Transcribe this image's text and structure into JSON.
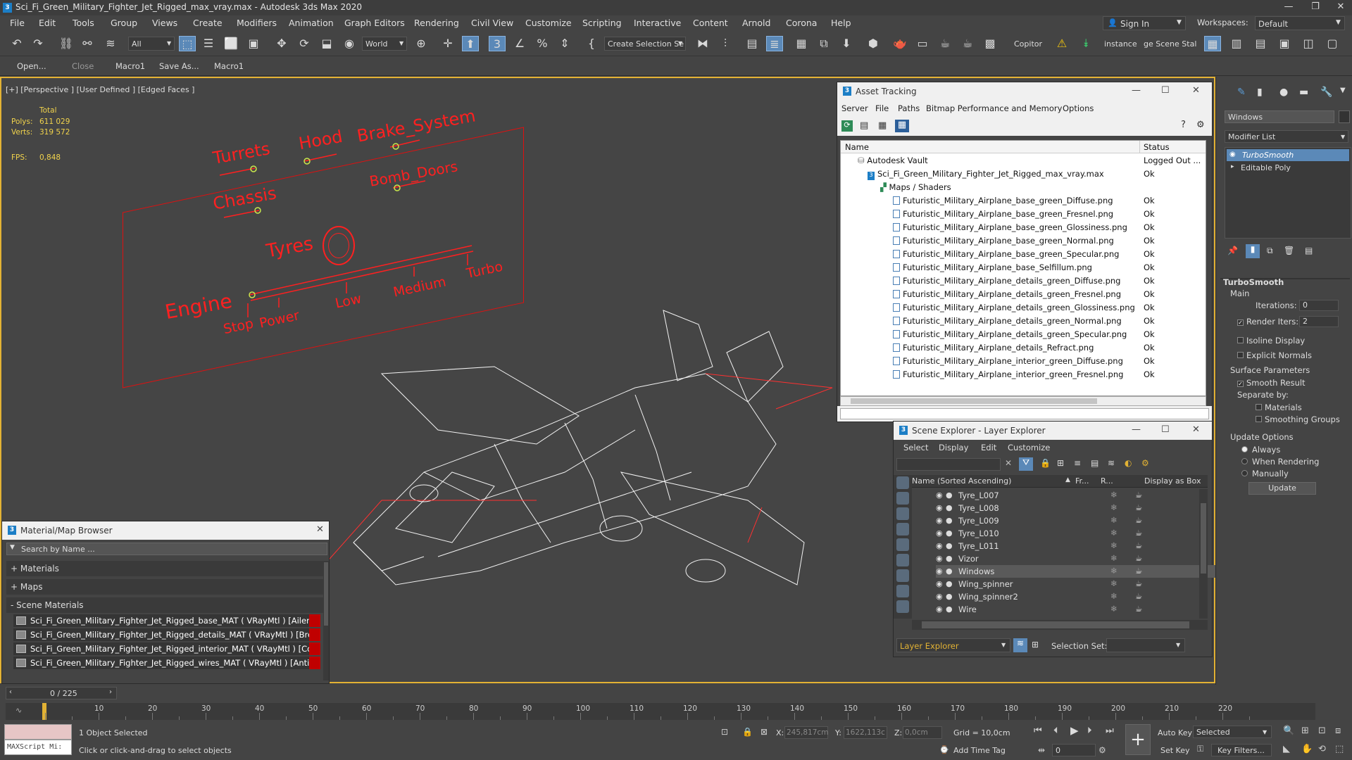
{
  "window": {
    "title": "Sci_Fi_Green_Military_Fighter_Jet_Rigged_max_vray.max - Autodesk 3ds Max 2020"
  },
  "menu": [
    "File",
    "Edit",
    "Tools",
    "Group",
    "Views",
    "Create",
    "Modifiers",
    "Animation",
    "Graph Editors",
    "Rendering",
    "Civil View",
    "Customize",
    "Scripting",
    "Interactive",
    "Content",
    "Arnold",
    "Corona",
    "Help"
  ],
  "account": {
    "sign_in": "Sign In",
    "workspaces_label": "Workspaces:",
    "workspace": "Default"
  },
  "toolbar": {
    "filter": "All",
    "coord": "World",
    "selection_set": "Create Selection Se",
    "copitor": "Copitor",
    "instance": "instance",
    "ge_scene": "ge Scene Stal"
  },
  "toolbar2": {
    "open": "Open...",
    "close": "Close",
    "macro1": "Macro1",
    "save_as": "Save As...",
    "macro1b": "Macro1"
  },
  "viewport": {
    "label": "[+] [Perspective ] [User Defined ] [Edged Faces ]",
    "stats_total": "Total",
    "polys_label": "Polys:",
    "polys": "611 029",
    "verts_label": "Verts:",
    "verts": "319 572",
    "fps_label": "FPS:",
    "fps": "0,848"
  },
  "rig_panel": {
    "turrets": "Turrets",
    "hood": "Hood",
    "brake": "Brake_System",
    "chassis": "Chassis",
    "bomb_doors": "Bomb_Doors",
    "tyres": "Tyres",
    "engine": "Engine",
    "stop": "Stop",
    "power": "Power",
    "low": "Low",
    "medium": "Medium",
    "turbo": "Turbo"
  },
  "asset_tracking": {
    "title": "Asset Tracking",
    "menu": [
      "Server",
      "File",
      "Paths",
      "Bitmap Performance and Memory",
      "Options"
    ],
    "col_name": "Name",
    "col_status": "Status",
    "vault": {
      "name": "Autodesk Vault",
      "status": "Logged Out ..."
    },
    "file": {
      "name": "Sci_Fi_Green_Military_Fighter_Jet_Rigged_max_vray.max",
      "status": "Ok"
    },
    "maps_folder": "Maps / Shaders",
    "maps": [
      {
        "name": "Futuristic_Military_Airplane_base_green_Diffuse.png",
        "status": "Ok"
      },
      {
        "name": "Futuristic_Military_Airplane_base_green_Fresnel.png",
        "status": "Ok"
      },
      {
        "name": "Futuristic_Military_Airplane_base_green_Glossiness.png",
        "status": "Ok"
      },
      {
        "name": "Futuristic_Military_Airplane_base_green_Normal.png",
        "status": "Ok"
      },
      {
        "name": "Futuristic_Military_Airplane_base_green_Specular.png",
        "status": "Ok"
      },
      {
        "name": "Futuristic_Military_Airplane_base_Selfillum.png",
        "status": "Ok"
      },
      {
        "name": "Futuristic_Military_Airplane_details_green_Diffuse.png",
        "status": "Ok"
      },
      {
        "name": "Futuristic_Military_Airplane_details_green_Fresnel.png",
        "status": "Ok"
      },
      {
        "name": "Futuristic_Military_Airplane_details_green_Glossiness.png",
        "status": "Ok"
      },
      {
        "name": "Futuristic_Military_Airplane_details_green_Normal.png",
        "status": "Ok"
      },
      {
        "name": "Futuristic_Military_Airplane_details_green_Specular.png",
        "status": "Ok"
      },
      {
        "name": "Futuristic_Military_Airplane_details_Refract.png",
        "status": "Ok"
      },
      {
        "name": "Futuristic_Military_Airplane_interior_green_Diffuse.png",
        "status": "Ok"
      },
      {
        "name": "Futuristic_Military_Airplane_interior_green_Fresnel.png",
        "status": "Ok"
      }
    ]
  },
  "scene_explorer": {
    "title": "Scene Explorer - Layer Explorer",
    "menu": [
      "Select",
      "Display",
      "Edit",
      "Customize"
    ],
    "col_name": "Name (Sorted Ascending)",
    "col_fr": "Fr...",
    "col_r": "R...",
    "col_box": "Display as Box",
    "rows": [
      "Tyre_L007",
      "Tyre_L008",
      "Tyre_L009",
      "Tyre_L010",
      "Tyre_L011",
      "Vizor",
      "Windows",
      "Wing_spinner",
      "Wing_spinner2",
      "Wire"
    ],
    "selected_row": "Windows",
    "layer_explorer": "Layer Explorer",
    "selection_set_label": "Selection Set:"
  },
  "material_browser": {
    "title": "Material/Map Browser",
    "search_placeholder": "Search by Name ...",
    "materials": "+ Materials",
    "maps": "+ Maps",
    "scene_materials": "- Scene Materials",
    "items": [
      "Sci_Fi_Green_Military_Fighter_Jet_Rigged_base_MAT ( VRayMtl ) [Aileron_LB,...",
      "Sci_Fi_Green_Military_Fighter_Jet_Rigged_details_MAT ( VRayMtl ) [Break_Di...",
      "Sci_Fi_Green_Military_Fighter_Jet_Rigged_interior_MAT ( VRayMtl ) [Cocpit, C...",
      "Sci_Fi_Green_Military_Fighter_Jet_Rigged_wires_MAT ( VRayMtl ) [Antigravity..."
    ]
  },
  "command_panel": {
    "object_name": "Windows",
    "modifier_list": "Modifier List",
    "stack": [
      "TurboSmooth",
      "Editable Poly"
    ],
    "rollout": "TurboSmooth",
    "main": "Main",
    "iterations_label": "Iterations:",
    "iterations": "0",
    "render_iters_label": "Render Iters:",
    "render_iters": "2",
    "isoline": "Isoline Display",
    "explicit_normals": "Explicit Normals",
    "surface_params": "Surface Parameters",
    "smooth_result": "Smooth Result",
    "separate_by": "Separate by:",
    "materials": "Materials",
    "smoothing_groups": "Smoothing Groups",
    "update_options": "Update Options",
    "always": "Always",
    "when_rendering": "When Rendering",
    "manually": "Manually",
    "update_btn": "Update"
  },
  "timeline": {
    "frame": "0 / 225",
    "ticks": [
      "10",
      "20",
      "30",
      "40",
      "50",
      "60",
      "70",
      "80",
      "90",
      "100",
      "110",
      "120",
      "130",
      "140",
      "150",
      "160",
      "170",
      "180",
      "190",
      "200",
      "210",
      "220"
    ]
  },
  "status": {
    "maxscript": "MAXScript Mi:",
    "selected": "1 Object Selected",
    "prompt": "Click or click-and-drag to select objects",
    "x_label": "X:",
    "x": "245,817cm",
    "y_label": "Y:",
    "y": "1622,113c",
    "z_label": "Z:",
    "z": "0,0cm",
    "grid": "Grid = 10,0cm",
    "add_time_tag": "Add Time Tag",
    "auto_key": "Auto Key",
    "set_key": "Set Key",
    "selected_dd": "Selected",
    "key_filters": "Key Filters...",
    "frame_value": "0"
  }
}
